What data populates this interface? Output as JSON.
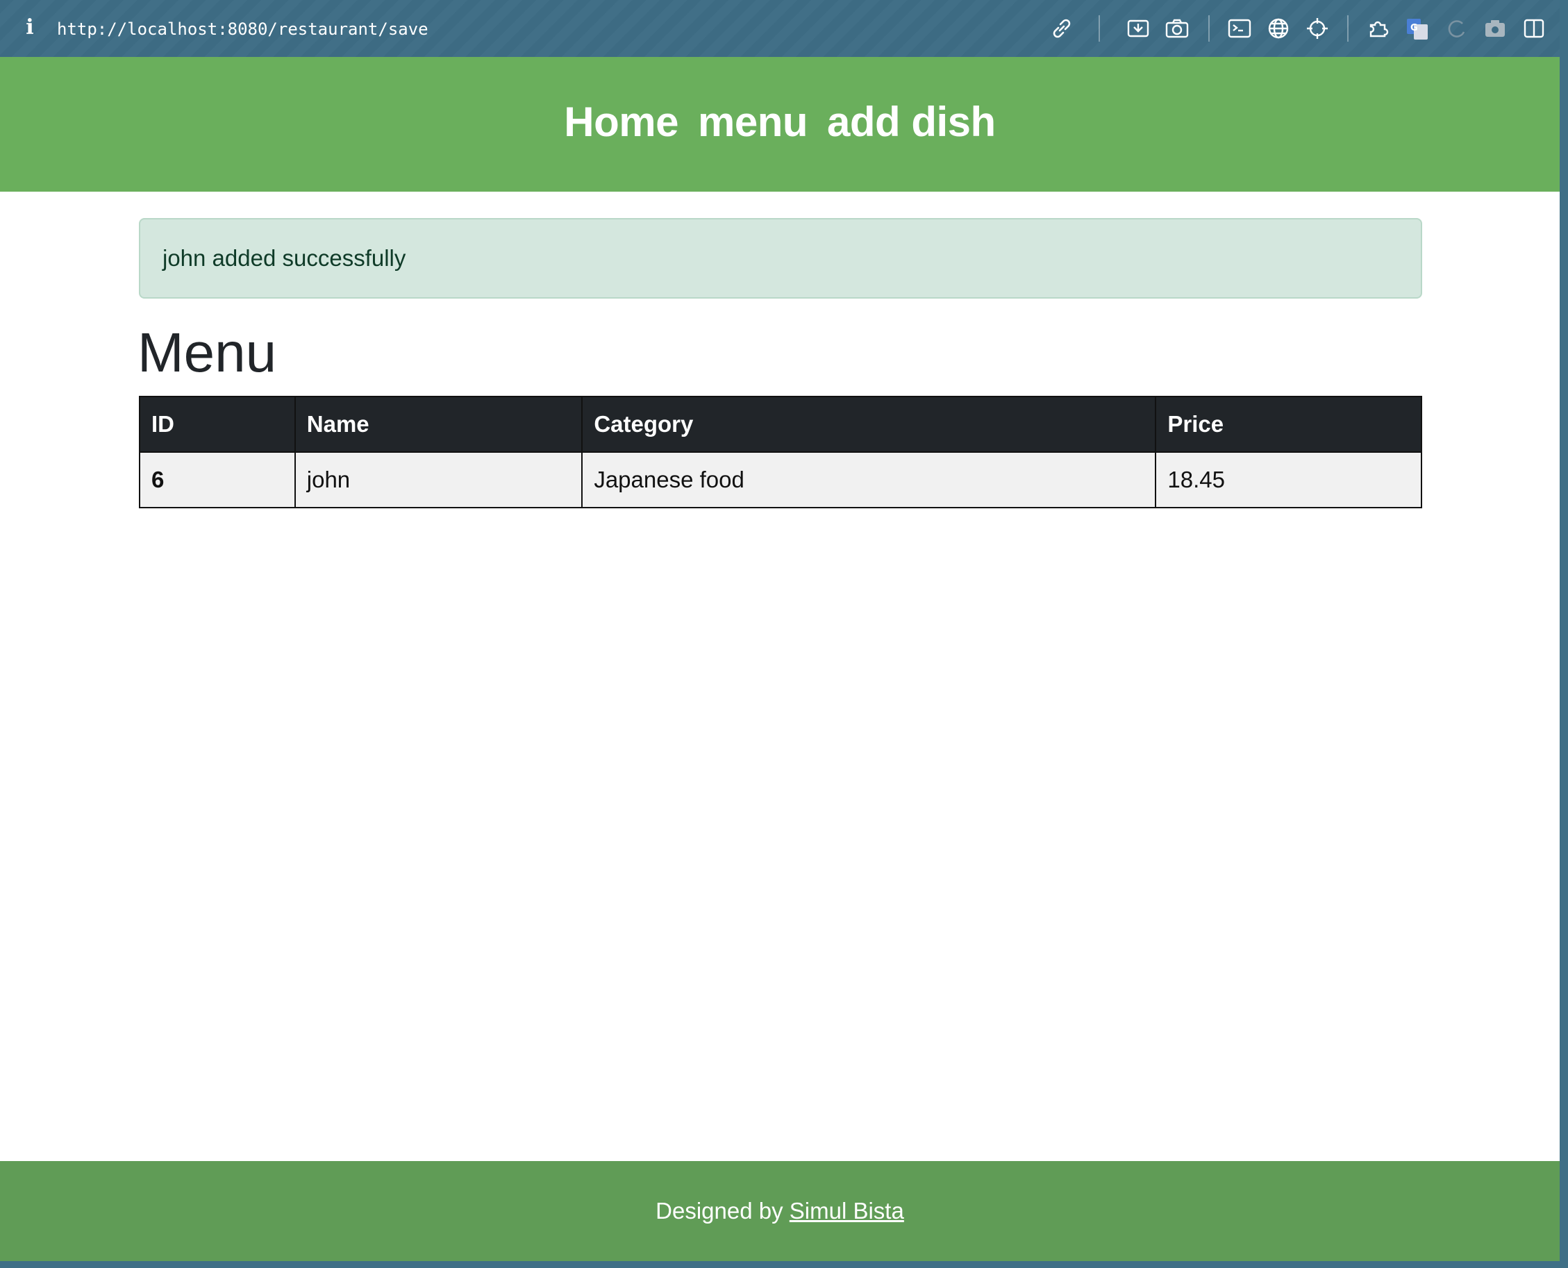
{
  "browser": {
    "url": "http://localhost:8080/restaurant/save",
    "info_glyph": "i",
    "toolbar_icons": [
      "link-icon",
      "screen-capture-icon",
      "camera-icon",
      "terminal-icon",
      "globe-icon",
      "crosshair-icon",
      "extensions-icon",
      "translate-icon",
      "reload-icon",
      "screenshot-icon",
      "sidebar-icon"
    ]
  },
  "header": {
    "nav": [
      {
        "label": "Home"
      },
      {
        "label": "menu"
      },
      {
        "label": "add dish"
      }
    ]
  },
  "alert": {
    "message": "john added successfully"
  },
  "main": {
    "title": "Menu",
    "table": {
      "headers": [
        "ID",
        "Name",
        "Category",
        "Price"
      ],
      "rows": [
        [
          "6",
          "john",
          "Japanese food",
          "18.45"
        ]
      ]
    }
  },
  "footer": {
    "prefix": "Designed by",
    "author": "Simul Bista"
  },
  "colors": {
    "header_bg": "#6aaf5c",
    "footer_bg": "#609c56",
    "alert_bg": "#d4e7de",
    "table_head_bg": "#212529",
    "table_row_bg": "#f1f1f1"
  }
}
